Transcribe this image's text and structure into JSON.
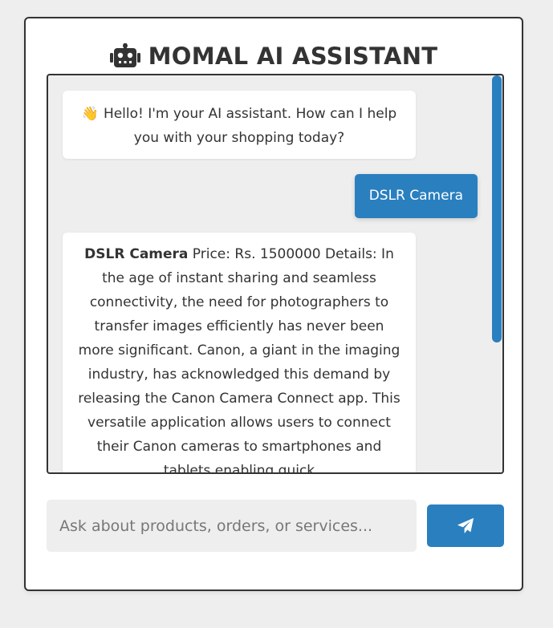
{
  "header": {
    "title": "MOMAL AI ASSISTANT",
    "icon": "robot-icon"
  },
  "chat": {
    "messages": [
      {
        "sender": "bot",
        "icon": "waving-hand-icon",
        "emoji": "👋",
        "text": "Hello! I'm your AI assistant. How can I help you with your shopping today?"
      },
      {
        "sender": "user",
        "text": "DSLR Camera"
      },
      {
        "sender": "bot",
        "product_name": "DSLR Camera",
        "text": " Price: Rs. 1500000 Details: In the age of instant sharing and seamless connectivity, the need for photographers to transfer images efficiently has never been more significant. Canon, a giant in the imaging industry, has acknowledged this demand by releasing the Canon Camera Connect app. This versatile application allows users to connect their Canon cameras to smartphones and tablets enabling quick"
      }
    ]
  },
  "input": {
    "placeholder": "Ask about products, orders, or services...",
    "value": ""
  },
  "send_button": {
    "icon": "paper-plane-icon"
  },
  "colors": {
    "accent": "#2a7fbf",
    "background": "#eeeeee",
    "card": "#ffffff",
    "text": "#333333"
  }
}
